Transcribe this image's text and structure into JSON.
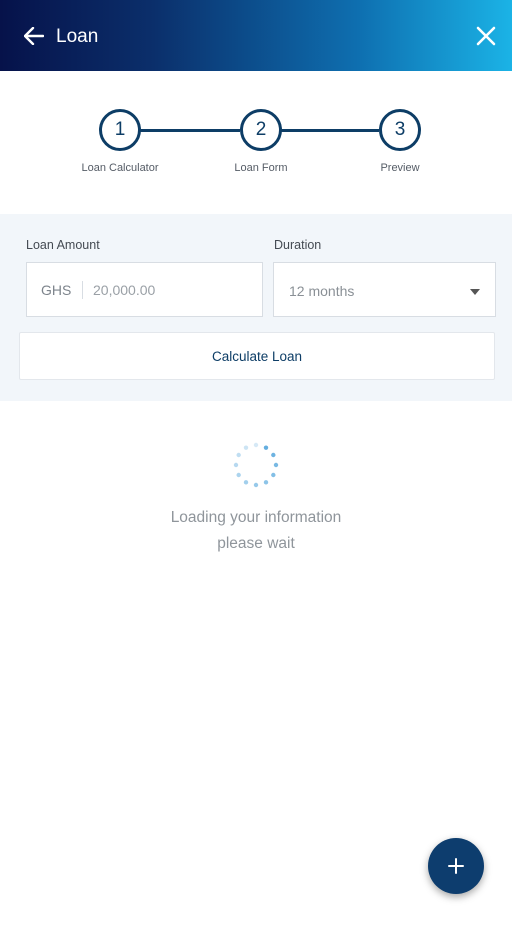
{
  "header": {
    "title": "Loan",
    "back_icon": "arrow-left-icon",
    "close_icon": "close-icon"
  },
  "stepper": {
    "steps": [
      {
        "number": "1",
        "label": "Loan Calculator"
      },
      {
        "number": "2",
        "label": "Loan Form"
      },
      {
        "number": "3",
        "label": "Preview"
      }
    ]
  },
  "form": {
    "amount_label": "Loan Amount",
    "currency": "GHS",
    "amount_value": "",
    "amount_placeholder": "20,000.00",
    "duration_label": "Duration",
    "duration_value": "12 months",
    "calculate_label": "Calculate Loan"
  },
  "loading": {
    "line1": "Loading your information",
    "line2": "please wait"
  },
  "fab": {
    "icon": "plus-icon"
  },
  "colors": {
    "primary": "#0d3d66",
    "header_gradient_start": "#06124a",
    "header_gradient_end": "#1bb3e6",
    "panel_bg": "#f2f6fa",
    "spinner": "#5aa9dd"
  }
}
